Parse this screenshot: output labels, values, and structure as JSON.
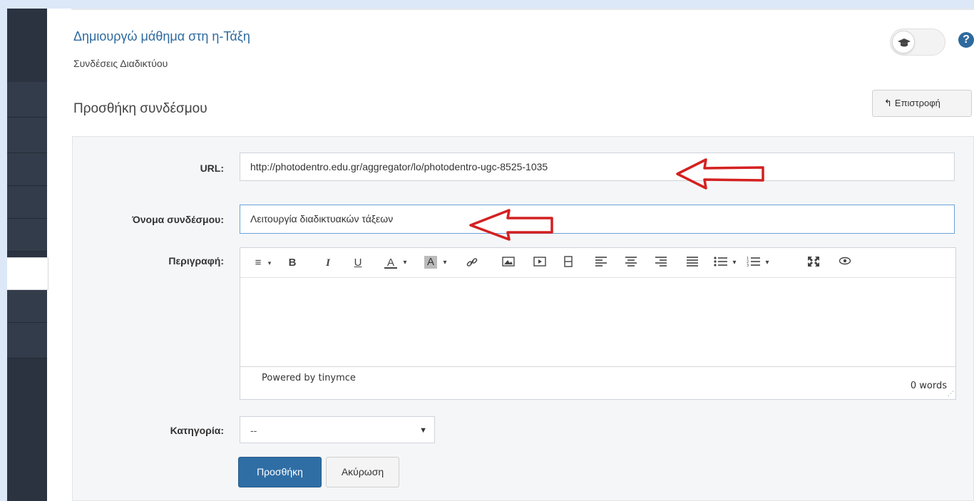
{
  "header": {
    "course_title": "Δημιουργώ μάθημα στη η-Τάξη",
    "module_title": "Συνδέσεις Διαδικτύου",
    "help_glyph": "?"
  },
  "panel": {
    "title": "Προσθήκη συνδέσμου",
    "back_label": "Επιστροφή"
  },
  "form": {
    "url_label": "URL:",
    "url_value": "http://photodentro.edu.gr/aggregator/lo/photodentro-ugc-8525-1035",
    "name_label": "Όνομα συνδέσμου:",
    "name_value": "Λειτουργία διαδικτυακών τάξεων",
    "description_label": "Περιγραφή:",
    "category_label": "Κατηγορία:",
    "category_selected": "--",
    "submit_label": "Προσθήκη",
    "cancel_label": "Ακύρωση"
  },
  "editor": {
    "powered_by": "Powered by tinymce",
    "word_count": "0 words",
    "toolbar_icons": [
      "format-icon",
      "bold-icon",
      "italic-icon",
      "underline-icon",
      "text-color-icon",
      "background-color-icon",
      "link-icon",
      "image-icon",
      "media-icon",
      "template-icon",
      "align-left-icon",
      "align-center-icon",
      "align-right-icon",
      "justify-icon",
      "bullet-list-icon",
      "numbered-list-icon",
      "fullscreen-icon",
      "preview-icon"
    ]
  },
  "colors": {
    "sidebar": "#2b3340",
    "accent": "#2e6a9e",
    "primary_button": "#2f6ea5",
    "annotation_arrow": "#d42020"
  }
}
